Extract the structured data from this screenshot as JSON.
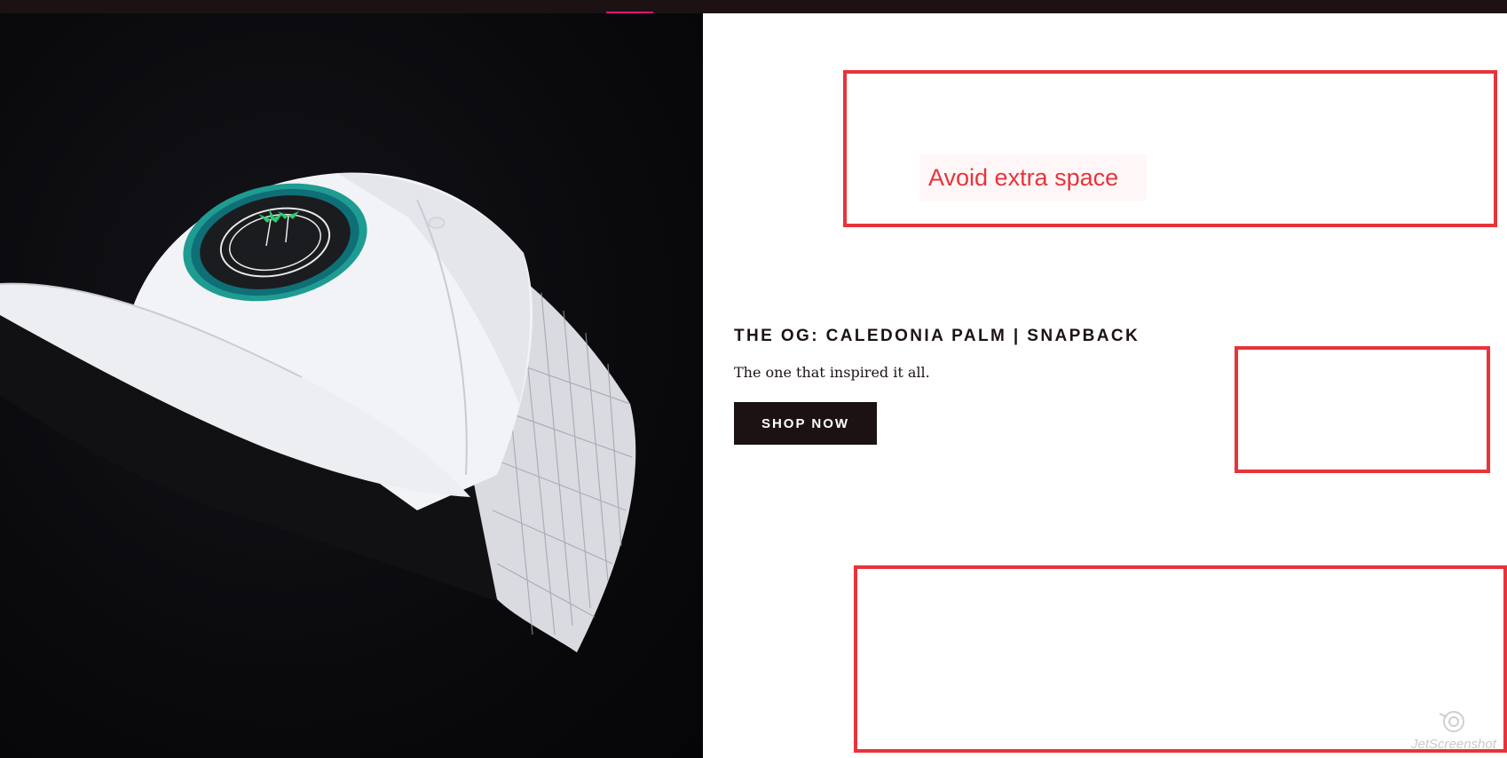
{
  "topbar": {
    "accent_color": "#e0137a"
  },
  "hero": {
    "image_alt": "White trucker snapback cap with round teal palm patch on black background"
  },
  "product": {
    "title": "THE OG: CALEDONIA PALM | SNAPBACK",
    "tagline": "The one that inspired it all.",
    "cta_label": "SHOP NOW"
  },
  "annotation": {
    "label": "Avoid extra space",
    "color": "#e8333a"
  },
  "watermark": {
    "text": "JetScreenshot"
  },
  "colors": {
    "brand_dark": "#1c1214",
    "background": "#ffffff"
  }
}
